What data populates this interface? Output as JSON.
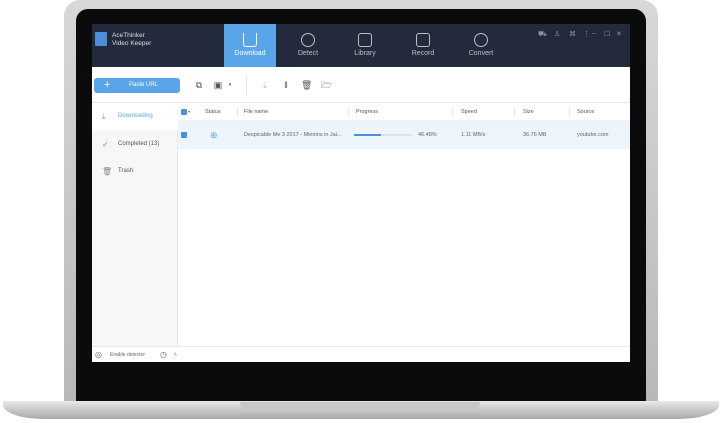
{
  "app": {
    "brand_line1": "AceThinker",
    "brand_line2": "Video Keeper"
  },
  "tabs": [
    {
      "label": "Download",
      "active": true
    },
    {
      "label": "Detect"
    },
    {
      "label": "Library"
    },
    {
      "label": "Record"
    },
    {
      "label": "Convert"
    }
  ],
  "toolbar": {
    "paste_url": "Paste URL"
  },
  "sidebar": [
    {
      "label": "Downloading",
      "active": true
    },
    {
      "label": "Completed (13)"
    },
    {
      "label": "Trash"
    }
  ],
  "table": {
    "headers": [
      "Status",
      "File name",
      "Progress",
      "Speed",
      "Size",
      "Source"
    ],
    "rows": [
      {
        "file": "Despicable Me 3  2017 - Minions in Jai...",
        "progress": 46.48,
        "progress_text": "46.48%",
        "speed": "1.11 MB/s",
        "size": "36.76 MB",
        "source": "youtube.com",
        "checked": true
      }
    ]
  },
  "footer": {
    "enable_detector": "Enable detector"
  },
  "colors": {
    "accent": "#5aa5e8",
    "header": "#222a3b"
  }
}
